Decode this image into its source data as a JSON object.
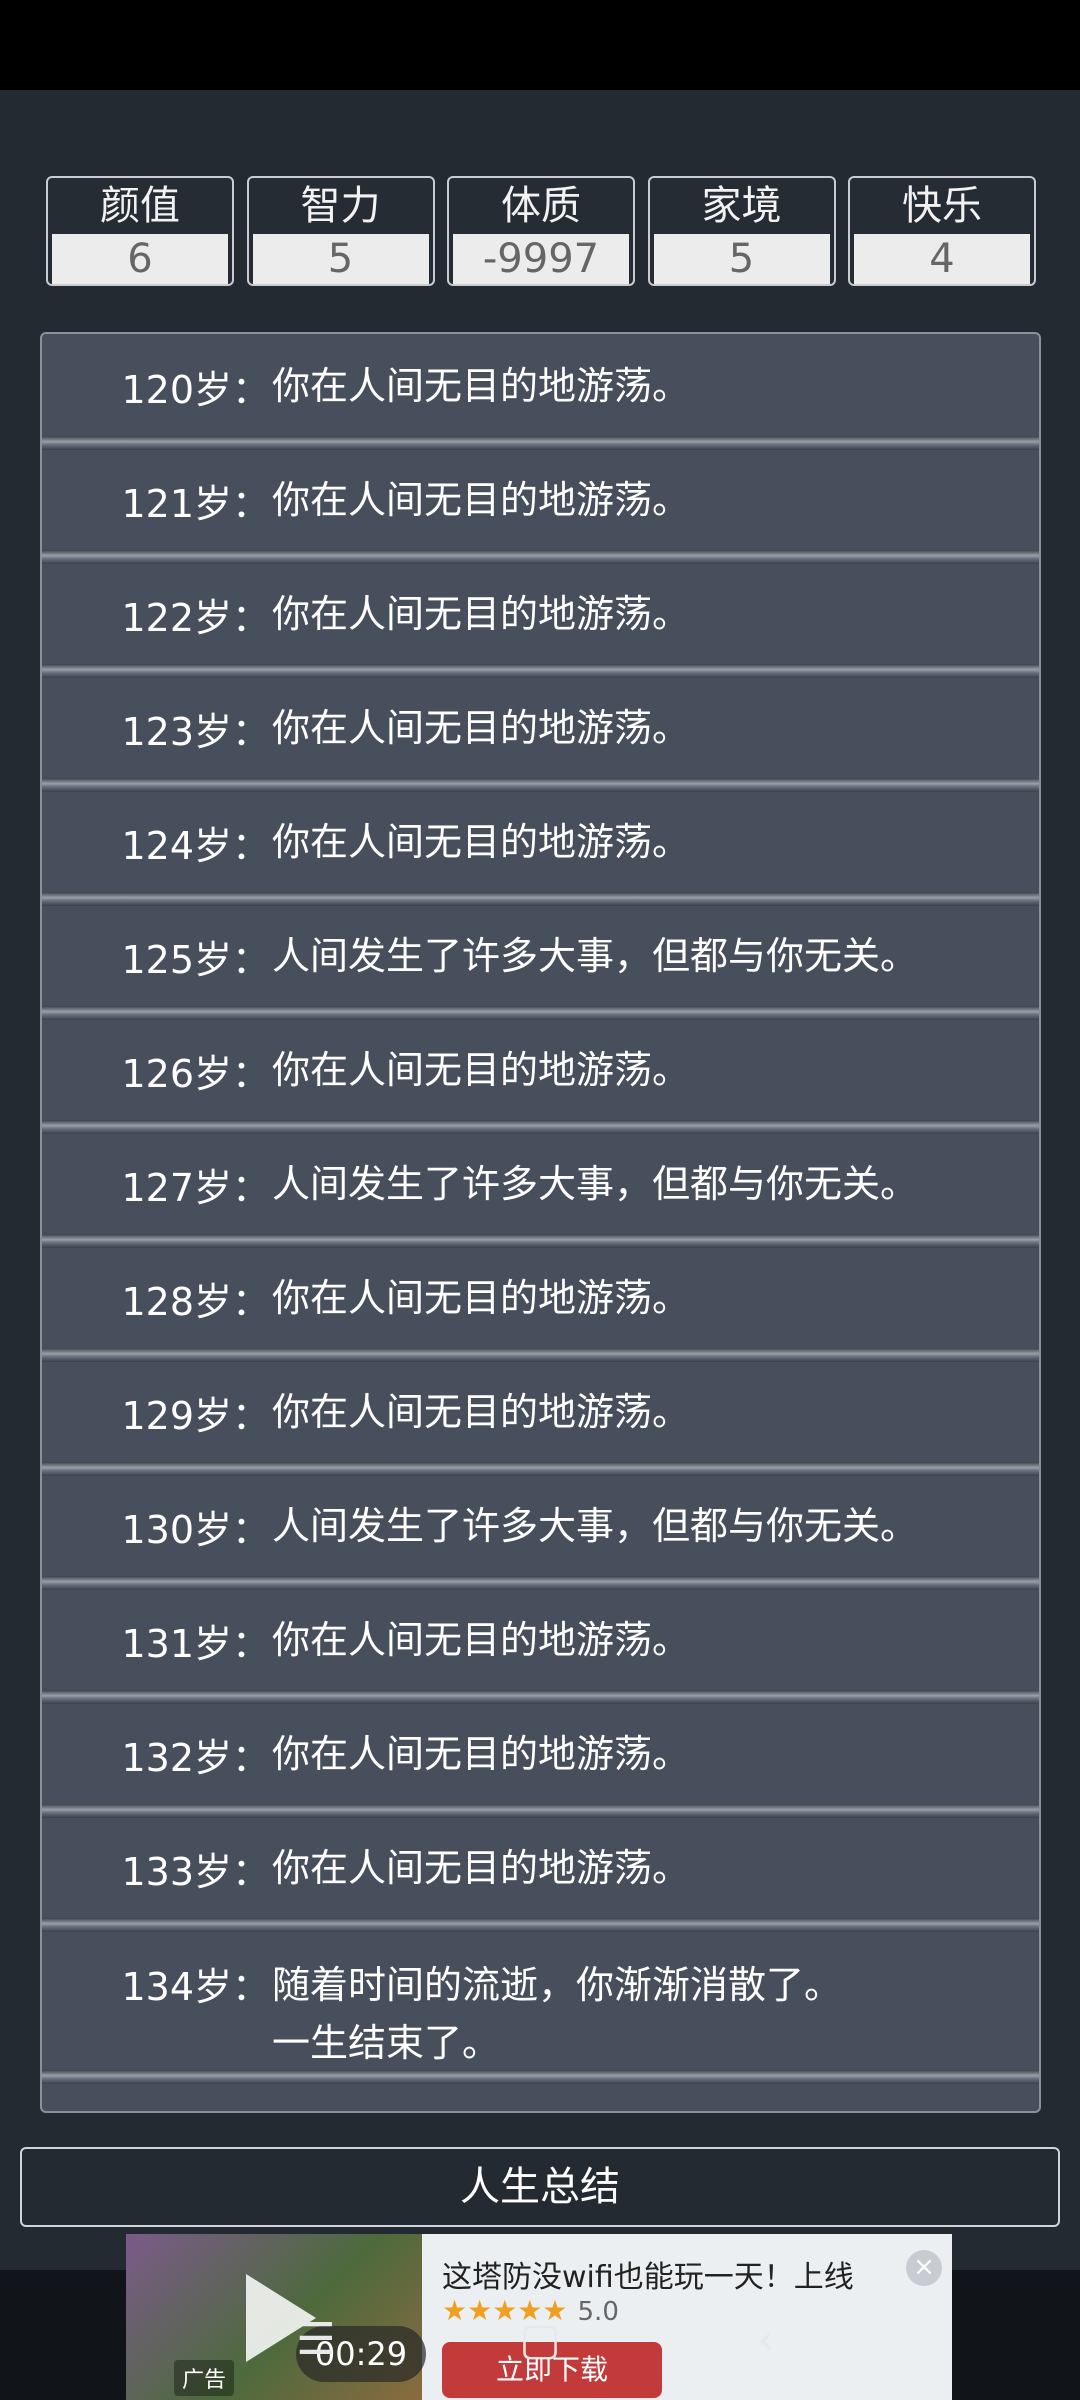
{
  "attributes": [
    {
      "label": "颜值",
      "value": "6"
    },
    {
      "label": "智力",
      "value": "5"
    },
    {
      "label": "体质",
      "value": "-9997"
    },
    {
      "label": "家境",
      "value": "5"
    },
    {
      "label": "快乐",
      "value": "4"
    }
  ],
  "log": [
    {
      "age": "120岁：",
      "text": "你在人间无目的地游荡。"
    },
    {
      "age": "121岁：",
      "text": "你在人间无目的地游荡。"
    },
    {
      "age": "122岁：",
      "text": "你在人间无目的地游荡。"
    },
    {
      "age": "123岁：",
      "text": "你在人间无目的地游荡。"
    },
    {
      "age": "124岁：",
      "text": "你在人间无目的地游荡。"
    },
    {
      "age": "125岁：",
      "text": "人间发生了许多大事，但都与你无关。"
    },
    {
      "age": "126岁：",
      "text": "你在人间无目的地游荡。"
    },
    {
      "age": "127岁：",
      "text": "人间发生了许多大事，但都与你无关。"
    },
    {
      "age": "128岁：",
      "text": "你在人间无目的地游荡。"
    },
    {
      "age": "129岁：",
      "text": "你在人间无目的地游荡。"
    },
    {
      "age": "130岁：",
      "text": "人间发生了许多大事，但都与你无关。"
    },
    {
      "age": "131岁：",
      "text": "你在人间无目的地游荡。"
    },
    {
      "age": "132岁：",
      "text": "你在人间无目的地游荡。"
    },
    {
      "age": "133岁：",
      "text": "你在人间无目的地游荡。"
    },
    {
      "age": "134岁：",
      "text": "随着时间的流逝，你渐渐消散了。",
      "text2": "一生结束了。"
    }
  ],
  "summary_button": "人生总结",
  "ad": {
    "label": "广告",
    "timer": "00:29",
    "title": "这塔防没wifi也能玩一天！上线",
    "stars": "★★★★★",
    "rating": "5.0",
    "download": "立即下载",
    "close_icon": "close-icon"
  },
  "nav": {
    "menu_icon": "☰",
    "home_icon": "▢",
    "back_icon": "‹"
  }
}
